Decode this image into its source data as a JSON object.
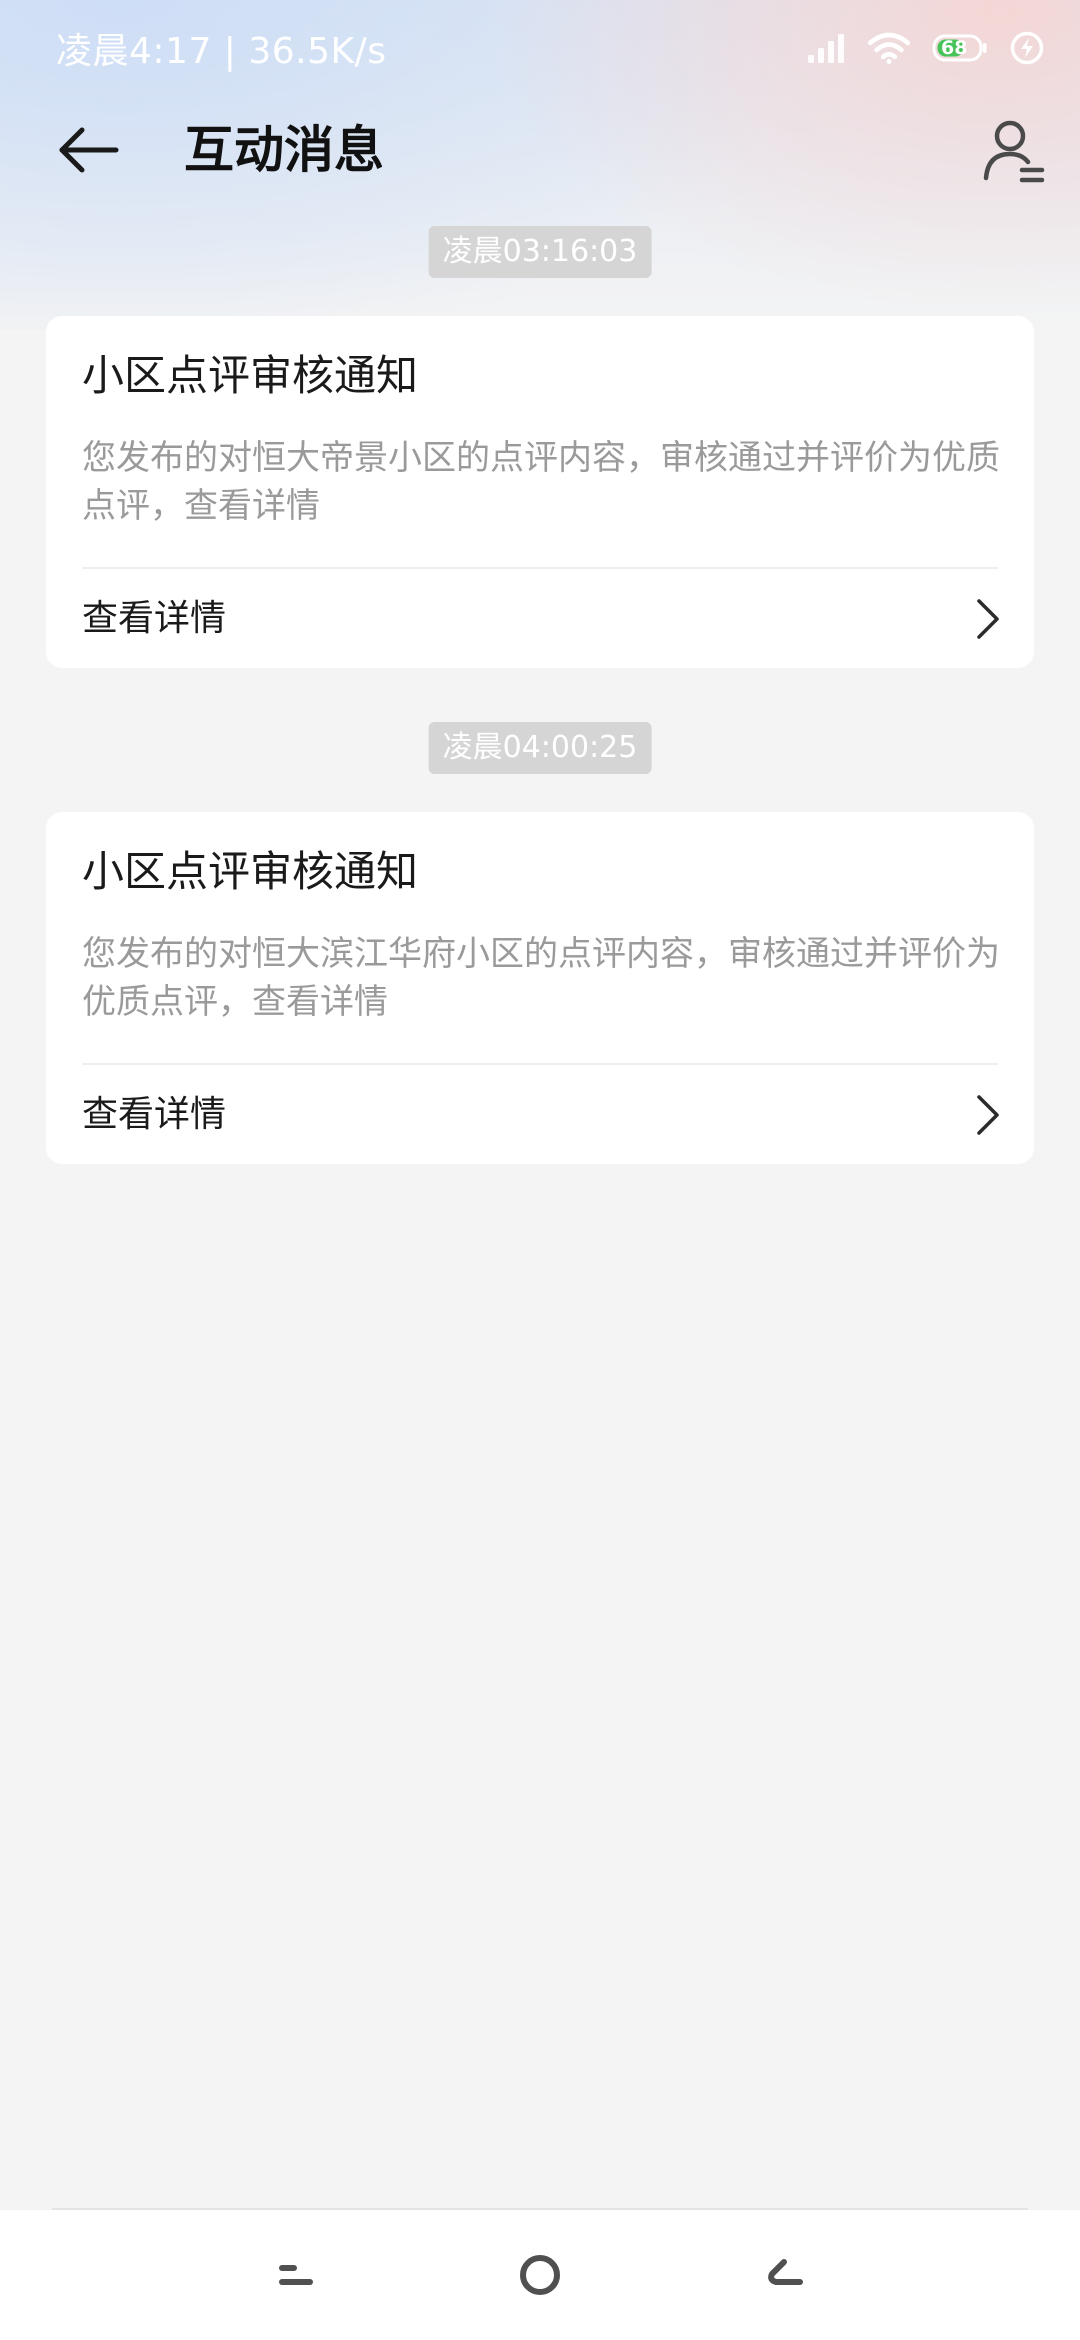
{
  "status_bar": {
    "time_text": "凌晨4:17 | 36.5K/s",
    "battery_level": "68"
  },
  "header": {
    "title": "互动消息"
  },
  "messages": [
    {
      "timestamp": "凌晨03:16:03",
      "title": "小区点评审核通知",
      "body": "您发布的对恒大帝景小区的点评内容，审核通过并评价为优质点评，查看详情",
      "action_label": "查看详情"
    },
    {
      "timestamp": "凌晨04:00:25",
      "title": "小区点评审核通知",
      "body": "您发布的对恒大滨江华府小区的点评内容，审核通过并评价为优质点评，查看详情",
      "action_label": "查看详情"
    }
  ],
  "colors": {
    "battery_green": "#46c45a",
    "chip_background": "#d5d5d6",
    "secondary_text": "#9a9a9a"
  },
  "icons": {
    "back": "arrow-left-icon",
    "profile": "user-settings-icon",
    "chevron": "chevron-right-icon",
    "nav_menu": "menu-icon",
    "nav_home": "home-circle-icon",
    "nav_back": "back-gesture-icon"
  }
}
